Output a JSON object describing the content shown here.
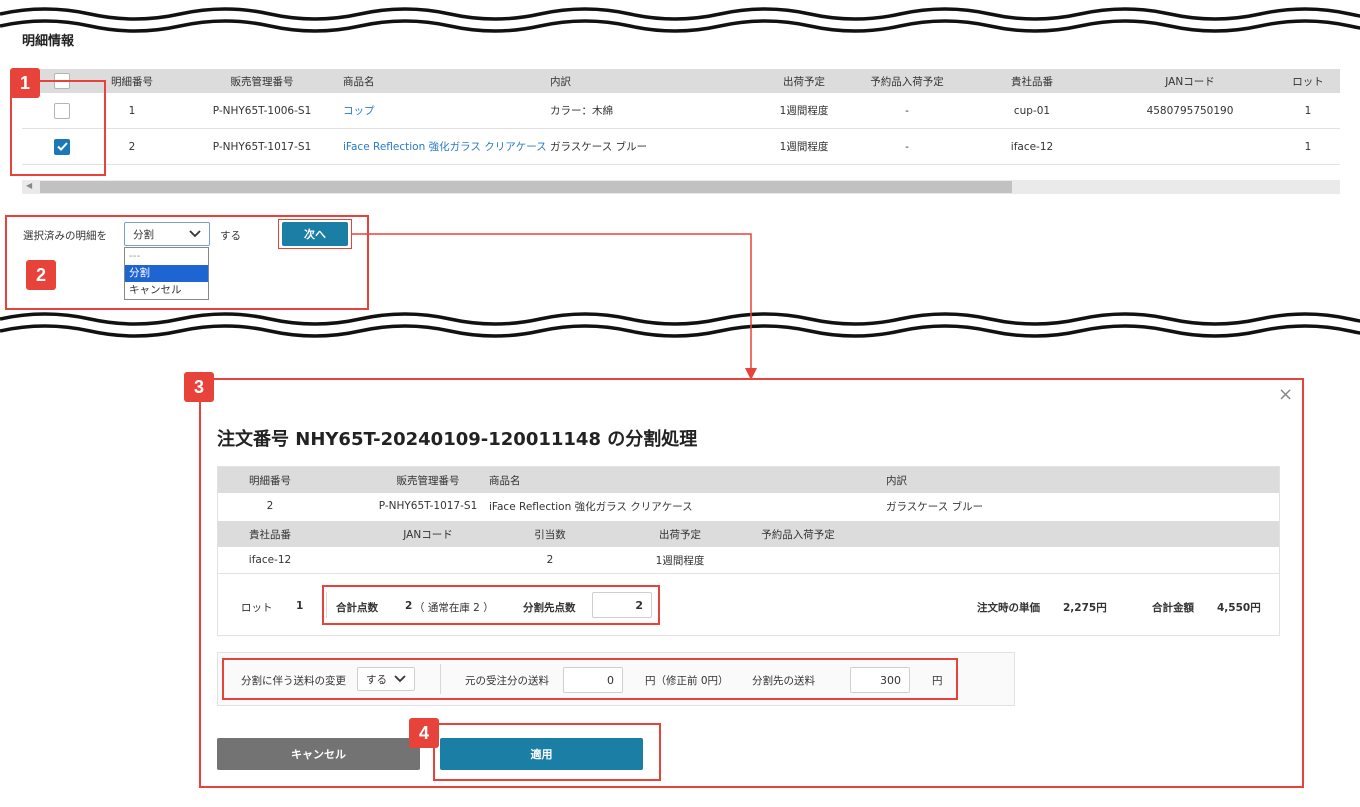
{
  "section": {
    "title": "明細情報"
  },
  "table": {
    "headers": [
      "明細番号",
      "販売管理番号",
      "商品名",
      "内訳",
      "出荷予定",
      "予約品入荷予定",
      "貴社品番",
      "JANコード",
      "ロット"
    ],
    "rows": [
      {
        "checked": false,
        "no": "1",
        "sales_no": "P-NHY65T-1006-S1",
        "product": "コップ",
        "detail": "カラー：木綿",
        "ship": "1週間程度",
        "reserve": "-",
        "part_no": "cup-01",
        "jan": "4580795750190",
        "lot": "1"
      },
      {
        "checked": true,
        "no": "2",
        "sales_no": "P-NHY65T-1017-S1",
        "product": "iFace Reflection 強化ガラス クリアケース",
        "detail": "ガラスケース ブルー",
        "ship": "1週間程度",
        "reserve": "-",
        "part_no": "iface-12",
        "jan": "",
        "lot": "1"
      }
    ]
  },
  "action_bar": {
    "prefix": "選択済みの明細を",
    "select_value": "分割",
    "suffix": "する",
    "next_button": "次へ",
    "dropdown_options": [
      "---",
      "分割",
      "キャンセル"
    ],
    "dropdown_selected": "分割"
  },
  "badges": [
    "1",
    "2",
    "3",
    "4"
  ],
  "modal": {
    "title": "注文番号 NHY65T-20240109-120011148 の分割処理",
    "close": "×",
    "header1": [
      "明細番号",
      "販売管理番号",
      "商品名",
      "内訳"
    ],
    "row1": [
      "2",
      "P-NHY65T-1017-S1",
      "iFace Reflection 強化ガラス クリアケース",
      "ガラスケース ブルー"
    ],
    "header2": [
      "貴社品番",
      "JANコード",
      "引当数",
      "出荷予定",
      "予約品入荷予定"
    ],
    "row2": [
      "iface-12",
      "",
      "2",
      "1週間程度",
      ""
    ],
    "lot_label": "ロット",
    "lot_value": "1",
    "total_qty_label": "合計点数",
    "total_qty_value": "2",
    "total_qty_note": "（ 通常在庫 2 ）",
    "split_qty_label": "分割先点数",
    "split_qty_value": "2",
    "unit_price_label": "注文時の単価",
    "unit_price_value": "2,275円",
    "total_amount_label": "合計金額",
    "total_amount_value": "4,550円",
    "fee_change_label": "分割に伴う送料の変更",
    "fee_change_value": "する",
    "orig_fee_label": "元の受注分の送料",
    "orig_fee_value": "0",
    "orig_fee_unit": "円（修正前 0円）",
    "split_fee_label": "分割先の送料",
    "split_fee_value": "300",
    "split_fee_unit": "円",
    "cancel_button": "キャンセル",
    "apply_button": "適用"
  },
  "colors": {
    "accent": "#1a7ea5",
    "annotation": "#e8433a",
    "link": "#2878c8"
  }
}
